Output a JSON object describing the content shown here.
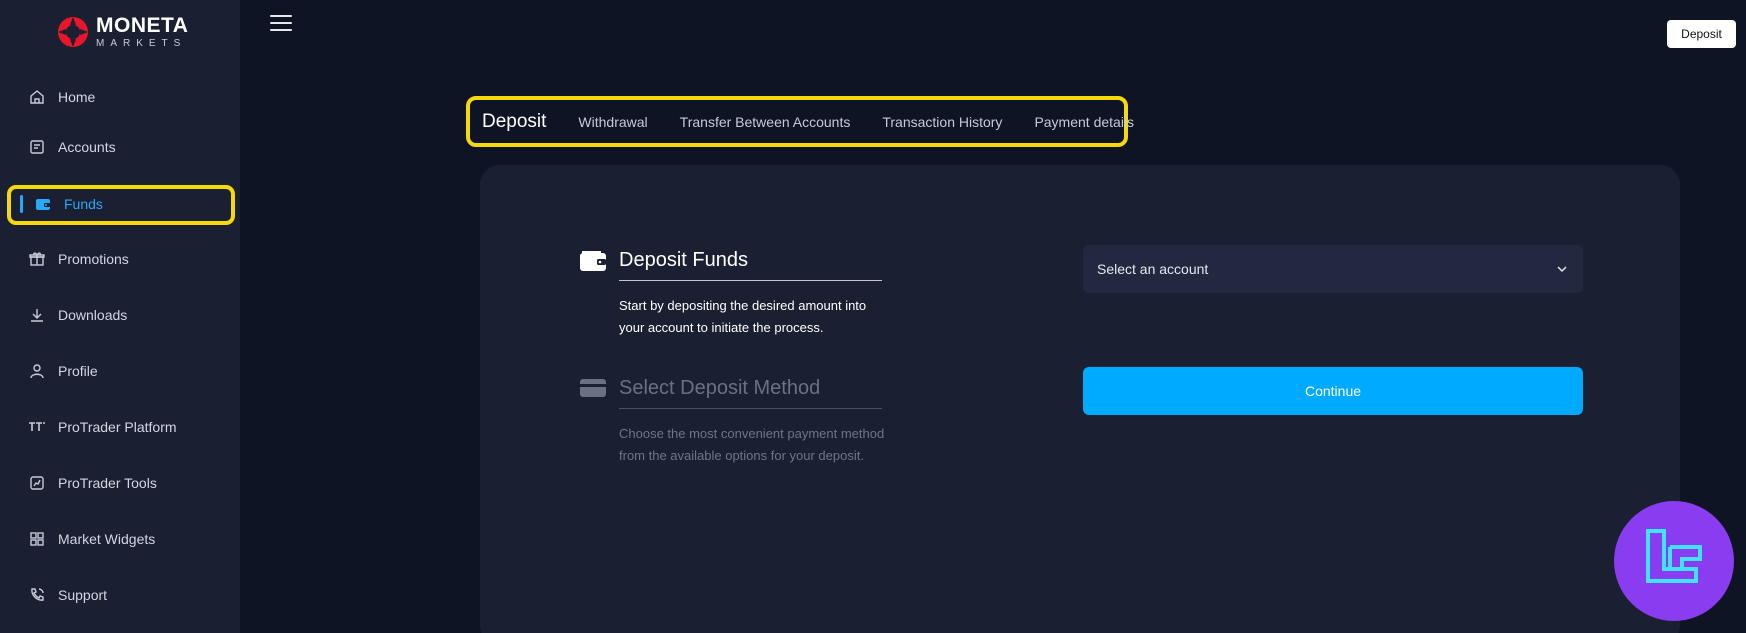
{
  "brand": {
    "name": "MONETA",
    "tagline": "MARKETS"
  },
  "sidebar": {
    "items": [
      {
        "label": "Home",
        "icon": "home-icon"
      },
      {
        "label": "Accounts",
        "icon": "accounts-icon"
      },
      {
        "label": "Funds",
        "icon": "wallet-icon",
        "active": true
      },
      {
        "label": "Promotions",
        "icon": "gift-icon"
      },
      {
        "label": "Downloads",
        "icon": "download-icon"
      },
      {
        "label": "Profile",
        "icon": "user-icon"
      },
      {
        "label": "ProTrader Platform",
        "icon": "protrader-icon"
      },
      {
        "label": "ProTrader Tools",
        "icon": "chart-icon"
      },
      {
        "label": "Market Widgets",
        "icon": "widgets-icon"
      },
      {
        "label": "Support",
        "icon": "phone-icon"
      }
    ]
  },
  "header": {
    "deposit_label": "Deposit"
  },
  "tabs": [
    {
      "label": "Deposit",
      "active": true
    },
    {
      "label": "Withdrawal"
    },
    {
      "label": "Transfer Between Accounts"
    },
    {
      "label": "Transaction History"
    },
    {
      "label": "Payment details"
    }
  ],
  "steps": [
    {
      "title": "Deposit Funds",
      "description": "Start by depositing the desired amount into your account to initiate the process.",
      "icon": "wallet-icon"
    },
    {
      "title": "Select Deposit Method",
      "description": "Choose the most convenient payment method from the available options for your deposit.",
      "icon": "card-icon"
    }
  ],
  "form": {
    "account_placeholder": "Select an account",
    "continue_label": "Continue"
  },
  "colors": {
    "accent": "#00aaff",
    "highlight": "#f5d90a",
    "sidebar": "#1a1f32",
    "background": "#0f1424",
    "badge": "#8a3cf0"
  }
}
